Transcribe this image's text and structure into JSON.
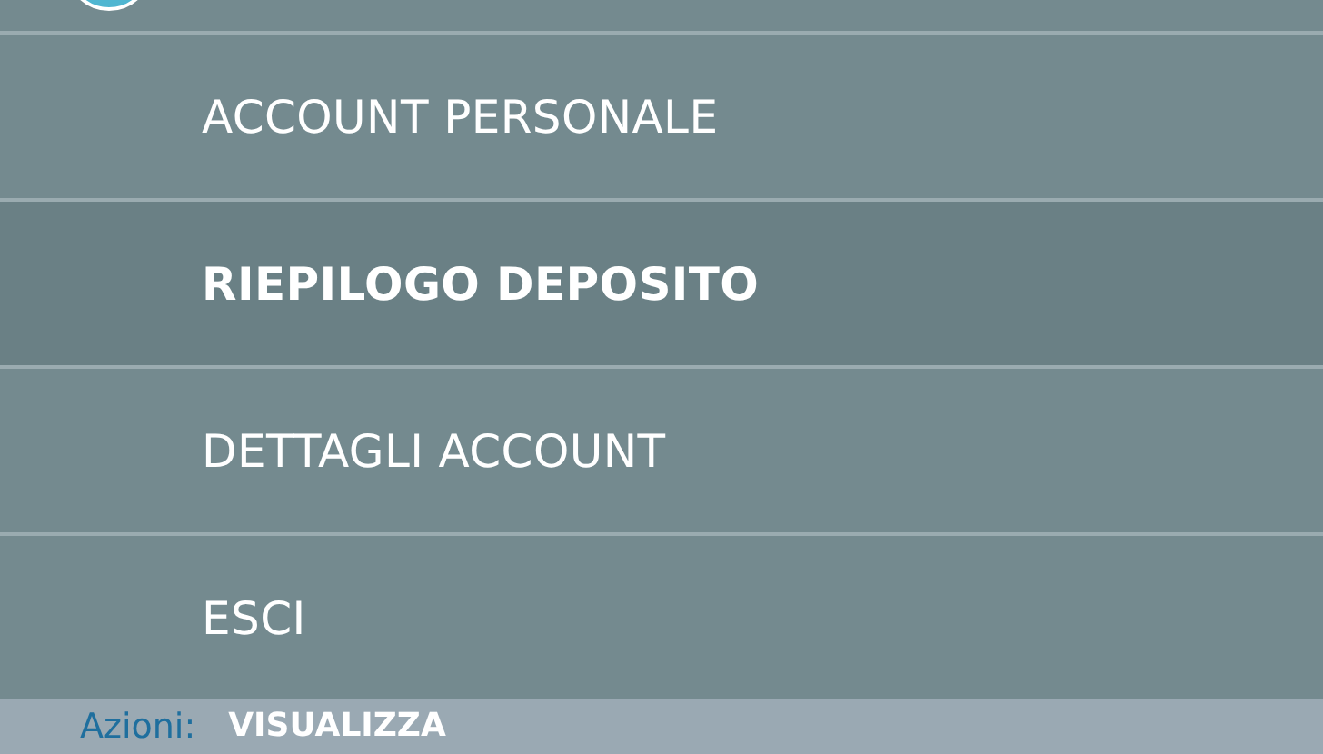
{
  "menu": {
    "items": [
      {
        "label": "ACCOUNT PERSONALE",
        "selected": false
      },
      {
        "label": "RIEPILOGO DEPOSITO",
        "selected": true
      },
      {
        "label": "DETTAGLI ACCOUNT",
        "selected": false
      },
      {
        "label": "ESCI",
        "selected": false
      }
    ]
  },
  "footer": {
    "label": "Azioni:",
    "action": "VISUALIZZA"
  }
}
